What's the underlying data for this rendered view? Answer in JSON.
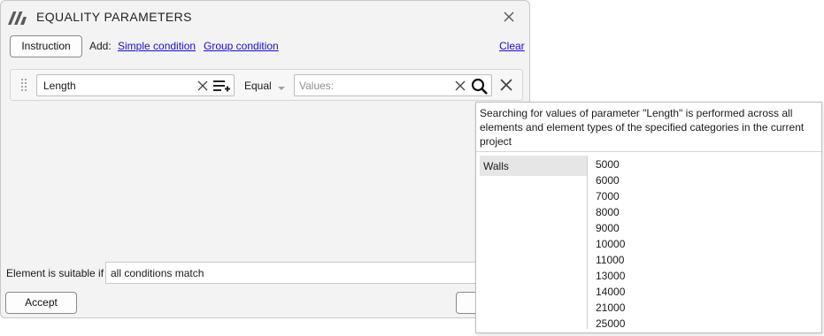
{
  "window": {
    "title": "EQUALITY PARAMETERS"
  },
  "toolbar": {
    "instruction_label": "Instruction",
    "add_label": "Add:",
    "simple_condition_label": "Simple condition",
    "group_condition_label": "Group condition",
    "clear_label": "Clear"
  },
  "condition": {
    "parameter_value": "Length",
    "operator": "Equal",
    "values_placeholder": "Values:"
  },
  "footer": {
    "suitable_label": "Element is suitable if",
    "match_value": "all conditions match",
    "accept_label": "Accept"
  },
  "popup": {
    "message": "Searching for values of parameter \"Length\" is performed across all elements and element types of the specified categories in the current project",
    "categories": [
      "Walls"
    ],
    "values": [
      "5000",
      "6000",
      "7000",
      "8000",
      "9000",
      "10000",
      "11000",
      "13000",
      "14000",
      "21000",
      "25000"
    ]
  }
}
